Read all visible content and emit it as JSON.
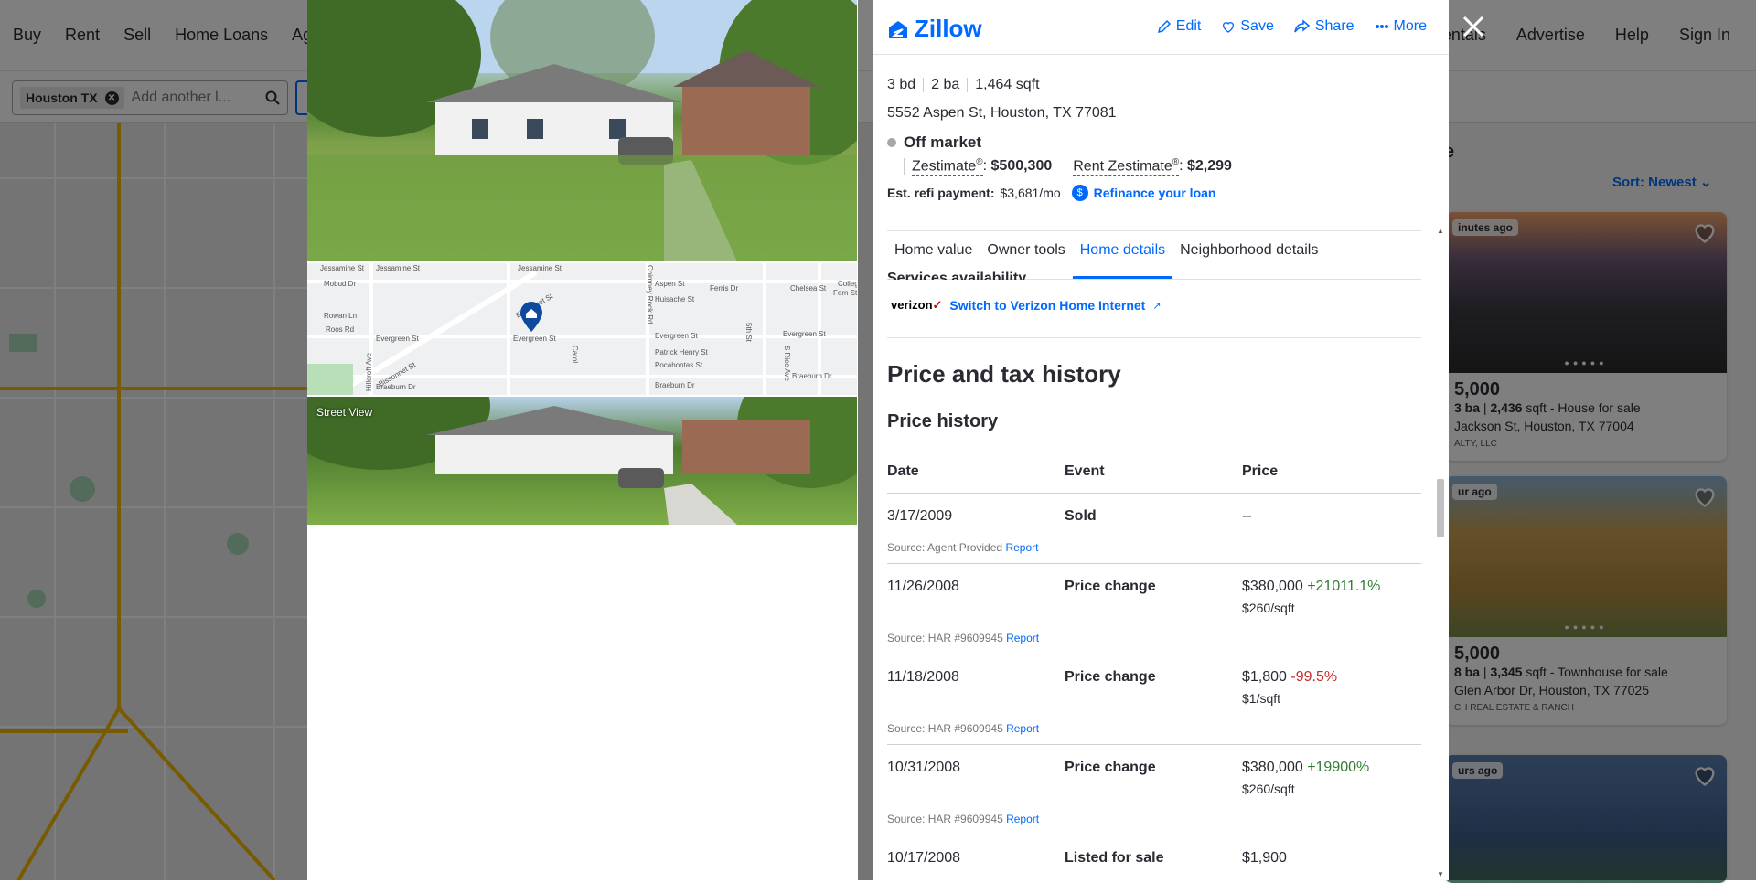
{
  "top_nav": {
    "left": [
      "Buy",
      "Rent",
      "Sell",
      "Home Loans",
      "Age"
    ],
    "right": [
      "Rentals",
      "Advertise",
      "Help",
      "Sign In"
    ]
  },
  "search": {
    "chip": "Houston TX",
    "placeholder": "Add another l..."
  },
  "listings": {
    "heading_fragment": "e",
    "sort_label": "Sort: Newest",
    "cards": [
      {
        "badge": "inutes ago",
        "price": "5,000",
        "beds": "3 ba",
        "sqft": "2,436",
        "sqft_unit": "sqft",
        "type": "- House for sale",
        "address": "Jackson St, Houston, TX 77004",
        "broker": "ALTY, LLC"
      },
      {
        "badge": "ur ago",
        "price": "5,000",
        "beds": "8 ba",
        "sqft": "3,345",
        "sqft_unit": "sqft",
        "type": "- Townhouse for sale",
        "address": "Glen Arbor Dr, Houston, TX 77025",
        "broker": "CH REAL ESTATE & RANCH"
      },
      {
        "badge": "urs ago",
        "price": "",
        "beds": "",
        "sqft": "",
        "sqft_unit": "",
        "type": "",
        "address": "",
        "broker": ""
      }
    ]
  },
  "gallery": {
    "street_view_label": "Street View",
    "map_labels": [
      "Jessamine St",
      "Jessamine St",
      "Jessamine St",
      "Mobud Dr",
      "Aspen St",
      "Huisache St",
      "Rowan Ln",
      "Ferris Dr",
      "Fern St",
      "Chelsea St",
      "College St",
      "Roos Rd",
      "Evergreen St",
      "Evergreen St",
      "Evergreen St",
      "Evergreen St",
      "Bissonnet St",
      "Bissonnet St",
      "Hillcroft Ave",
      "Chimney Rock Rd",
      "Patrick Henry St",
      "Pocahontas St",
      "Braeburn Dr",
      "Braeburn Dr",
      "Braeburn Dr",
      "S Rice Ave",
      "5th St",
      "Carol"
    ]
  },
  "header": {
    "logo": "Zillow",
    "actions": [
      {
        "label": "Edit",
        "icon": "pencil-icon"
      },
      {
        "label": "Save",
        "icon": "heart-icon"
      },
      {
        "label": "Share",
        "icon": "share-icon"
      },
      {
        "label": "More",
        "icon": "more-dots-icon"
      }
    ]
  },
  "property": {
    "beds": "3 bd",
    "baths": "2 ba",
    "sqft": "1,464 sqft",
    "address": "5552 Aspen St, Houston, TX 77081",
    "status": "Off market",
    "zestimate_label": "Zestimate",
    "zestimate_sup": "®",
    "zestimate_value": "$500,300",
    "rent_label": "Rent Zestimate",
    "rent_sup": "®",
    "rent_value": "$2,299",
    "refi_label": "Est. refi payment:",
    "refi_value": "$3,681/mo",
    "refi_icon": "$",
    "refi_link": "Refinance your loan"
  },
  "tabs": [
    "Home value",
    "Owner tools",
    "Home details",
    "Neighborhood details"
  ],
  "services": {
    "heading": "Services availability",
    "brand": "verizon",
    "link": "Switch to Verizon Home Internet"
  },
  "history": {
    "title": "Price and tax history",
    "subtitle": "Price history",
    "columns": [
      "Date",
      "Event",
      "Price"
    ],
    "rows": [
      {
        "date": "3/17/2009",
        "event": "Sold",
        "price": "--",
        "change": "",
        "dir": "",
        "per_sqft": "",
        "source": "Source: Agent Provided",
        "report": "Report"
      },
      {
        "date": "11/26/2008",
        "event": "Price change",
        "price": "$380,000",
        "change": "+21011.1%",
        "dir": "pos",
        "per_sqft": "$260/sqft",
        "source": "Source: HAR #9609945",
        "report": "Report"
      },
      {
        "date": "11/18/2008",
        "event": "Price change",
        "price": "$1,800",
        "change": "-99.5%",
        "dir": "neg",
        "per_sqft": "$1/sqft",
        "source": "Source: HAR #9609945",
        "report": "Report"
      },
      {
        "date": "10/31/2008",
        "event": "Price change",
        "price": "$380,000",
        "change": "+19900%",
        "dir": "pos",
        "per_sqft": "$260/sqft",
        "source": "Source: HAR #9609945",
        "report": "Report"
      },
      {
        "date": "10/17/2008",
        "event": "Listed for sale",
        "price": "$1,900",
        "change": "",
        "dir": "",
        "per_sqft": "",
        "source": "",
        "report": ""
      }
    ]
  },
  "colors": {
    "brand": "#006aff",
    "positive": "#2e7d32",
    "negative": "#c62828"
  }
}
